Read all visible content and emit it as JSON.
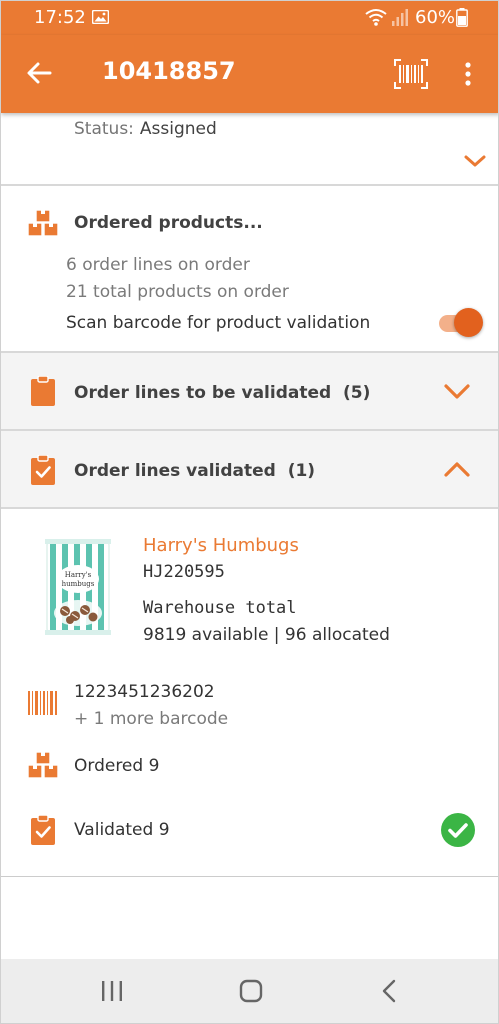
{
  "status_bar": {
    "time": "17:52",
    "battery": "60%",
    "icons": [
      "image-icon",
      "wifi-icon",
      "signal-icon",
      "battery-icon"
    ]
  },
  "app_bar": {
    "title": "10418857",
    "icons": [
      "back-arrow-icon",
      "barcode-scan-icon",
      "more-vertical-icon"
    ]
  },
  "order_status": {
    "label": "Status:",
    "value": "Assigned"
  },
  "ordered_products": {
    "title": "Ordered products...",
    "order_lines": "6 order lines on order",
    "total_products": "21 total products on order",
    "scan_label": "Scan barcode for product validation",
    "scan_enabled": true
  },
  "sections": {
    "to_validate": {
      "label": "Order lines to be validated",
      "count": "(5)",
      "expanded": false
    },
    "validated": {
      "label": "Order lines validated",
      "count": "(1)",
      "expanded": true
    }
  },
  "product": {
    "image_caption_line1": "Harry's",
    "image_caption_line2": "humbugs",
    "name": "Harry's Humbugs",
    "sku": "HJ220595",
    "warehouse_label": "Warehouse total",
    "stock": "9819 available | 96 allocated",
    "barcode": "1223451236202",
    "more_barcodes": "+ 1 more barcode",
    "ordered": "Ordered 9",
    "validated": "Validated 9"
  },
  "colors": {
    "accent": "#ea7a33",
    "toggle_thumb": "#e2611e",
    "success": "#3bb545",
    "nav_background": "#ededed"
  }
}
